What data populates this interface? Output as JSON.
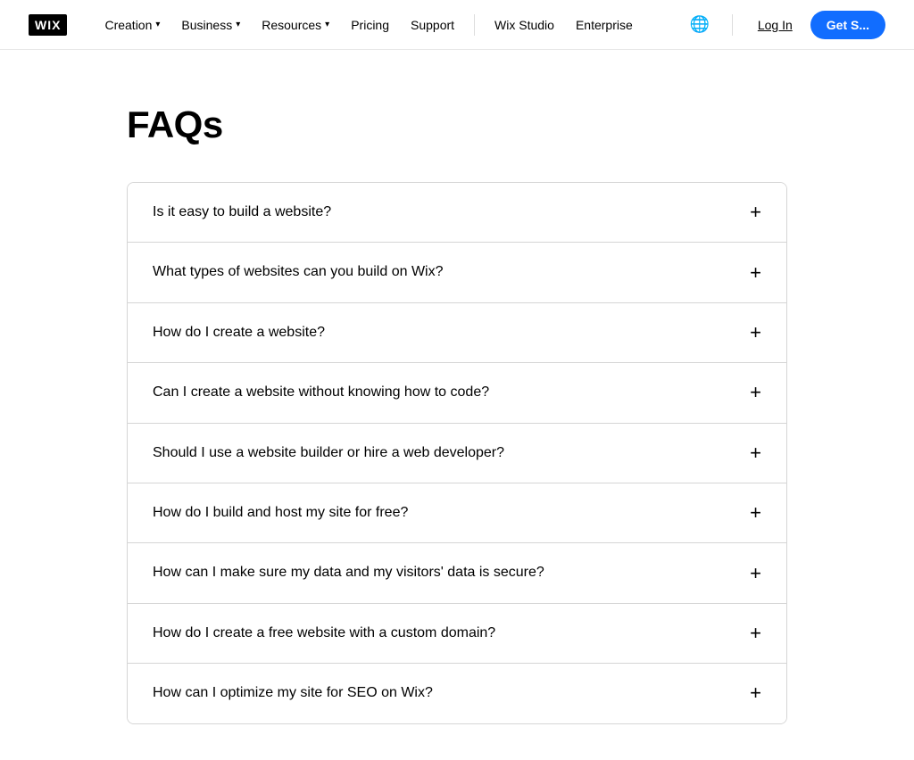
{
  "navbar": {
    "logo_text": "WIX",
    "nav_items": [
      {
        "label": "Creation",
        "has_chevron": true
      },
      {
        "label": "Business",
        "has_chevron": true
      },
      {
        "label": "Resources",
        "has_chevron": true
      },
      {
        "label": "Pricing",
        "has_chevron": false
      },
      {
        "label": "Support",
        "has_chevron": false
      },
      {
        "label": "Wix Studio",
        "has_chevron": false
      },
      {
        "label": "Enterprise",
        "has_chevron": false
      }
    ],
    "globe_icon": "🌐",
    "login_label": "Log In",
    "get_started_label": "Get S..."
  },
  "main": {
    "title": "FAQs",
    "faq_items": [
      {
        "question": "Is it easy to build a website?"
      },
      {
        "question": "What types of websites can you build on Wix?"
      },
      {
        "question": "How do I create a website?"
      },
      {
        "question": "Can I create a website without knowing how to code?"
      },
      {
        "question": "Should I use a website builder or hire a web developer?"
      },
      {
        "question": "How do I build and host my site for free?"
      },
      {
        "question": "How can I make sure my data and my visitors' data is secure?"
      },
      {
        "question": "How do I create a free website with a custom domain?"
      },
      {
        "question": "How can I optimize my site for SEO on Wix?"
      }
    ],
    "plus_symbol": "+"
  }
}
